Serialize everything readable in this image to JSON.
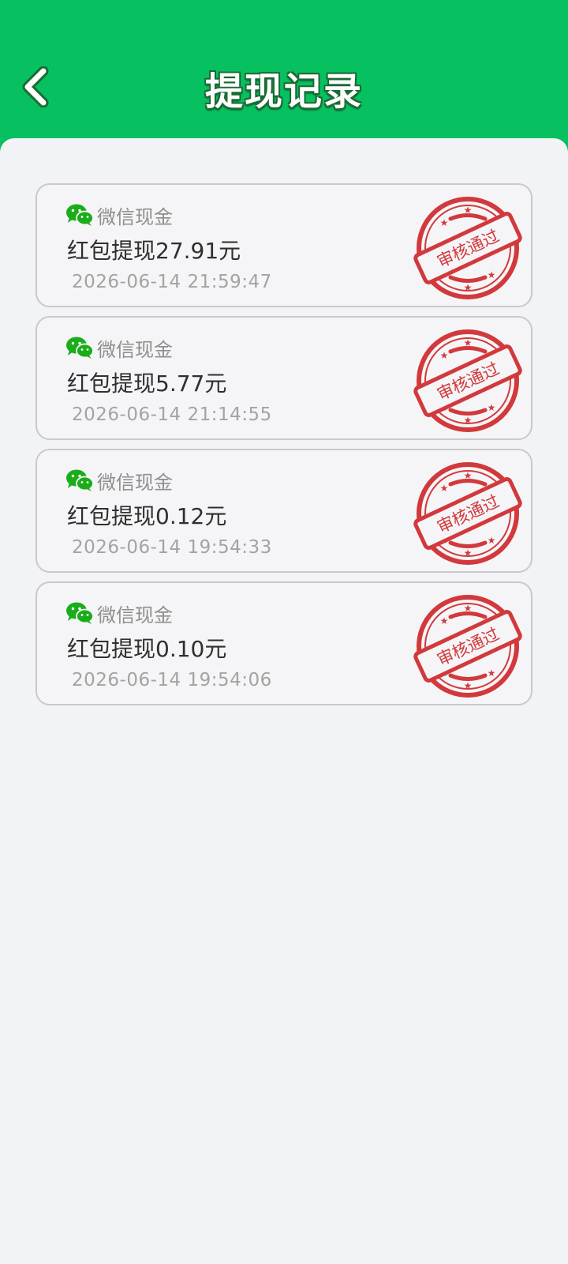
{
  "header": {
    "title": "提现记录",
    "back_icon": "chevron-left-icon",
    "color": "#07c160"
  },
  "records": [
    {
      "channel_label": "微信现金",
      "channel_icon": "wechat-icon",
      "amount_text": "红包提现27.91元",
      "time": "2026-06-14 21:59:47",
      "status": "审核通过"
    },
    {
      "channel_label": "微信现金",
      "channel_icon": "wechat-icon",
      "amount_text": "红包提现5.77元",
      "time": "2026-06-14 21:14:55",
      "status": "审核通过"
    },
    {
      "channel_label": "微信现金",
      "channel_icon": "wechat-icon",
      "amount_text": "红包提现0.12元",
      "time": "2026-06-14 19:54:33",
      "status": "审核通过"
    },
    {
      "channel_label": "微信现金",
      "channel_icon": "wechat-icon",
      "amount_text": "红包提现0.10元",
      "time": "2026-06-14 19:54:06",
      "status": "审核通过"
    }
  ],
  "colors": {
    "stamp": "#d2393c",
    "wechat": "#1aad19"
  }
}
